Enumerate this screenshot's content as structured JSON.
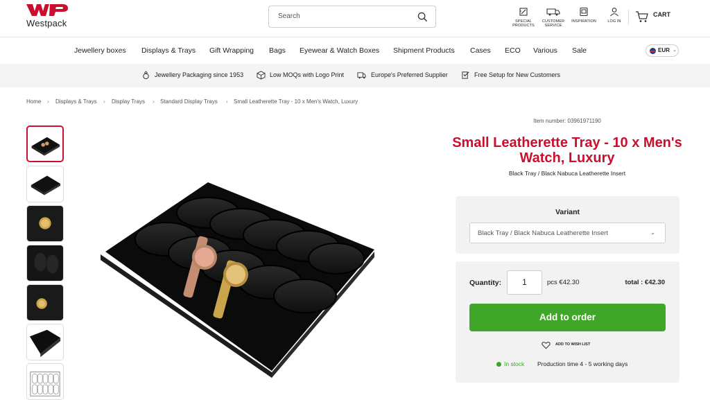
{
  "brand": {
    "name": "Westpack",
    "color": "#c8102e"
  },
  "search": {
    "placeholder": "Search"
  },
  "header_links": [
    {
      "label": "SPECIAL PRODUCTS",
      "icon": "pencil-ruler-icon"
    },
    {
      "label": "CUSTOMER SERVICE",
      "icon": "truck-icon"
    },
    {
      "label": "INSPIRATION",
      "icon": "image-frame-icon"
    },
    {
      "label": "LOG IN",
      "icon": "user-icon"
    }
  ],
  "cart": {
    "label": "CART"
  },
  "nav": [
    "Jewellery boxes",
    "Displays & Trays",
    "Gift Wrapping",
    "Bags",
    "Eyewear & Watch Boxes",
    "Shipment Products",
    "Cases",
    "ECO",
    "Various",
    "Sale"
  ],
  "currency": {
    "value": "EUR"
  },
  "usps": [
    {
      "label": "Jewellery Packaging since 1953",
      "icon": "ring-icon"
    },
    {
      "label": "Low MOQs with Logo Print",
      "icon": "box-icon"
    },
    {
      "label": "Europe's Preferred Supplier",
      "icon": "truck-icon"
    },
    {
      "label": "Free Setup for New Customers",
      "icon": "document-check-icon"
    }
  ],
  "breadcrumb": [
    "Home",
    "Displays & Trays",
    "Display Trays",
    "Standard Display Trays",
    "Small Leatherette Tray - 10 x Men's Watch, Luxury"
  ],
  "product": {
    "item_number": "Item number: 03961971190",
    "title": "Small Leatherette Tray - 10 x Men's Watch, Luxury",
    "subtitle": "Black Tray / Black Nabuca Leatherette Insert",
    "variant_heading": "Variant",
    "variant_selected": "Black Tray / Black Nabuca Leatherette Insert",
    "quantity_label": "Quantity:",
    "quantity": "1",
    "unit_price": "pcs €42.30",
    "total": "total : €42.30",
    "add_button": "Add to order",
    "wishlist": "ADD TO WISH LIST",
    "stock": "In stock",
    "production": "Production time 4 - 5 working days",
    "accent_green": "#3fa629"
  }
}
